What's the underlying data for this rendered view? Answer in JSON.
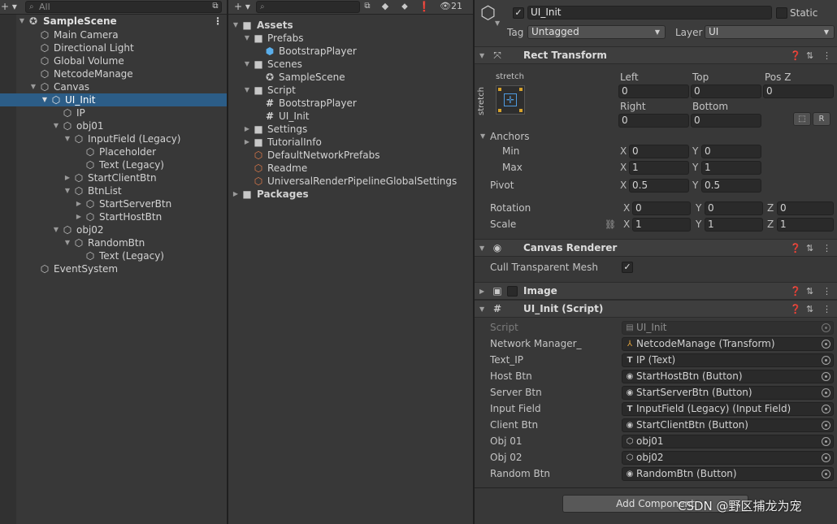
{
  "hierarchy": {
    "add_label": "+ ▾",
    "search_placeholder": "All",
    "scene_name": "SampleScene",
    "items": [
      {
        "label": "Main Camera"
      },
      {
        "label": "Directional Light"
      },
      {
        "label": "Global Volume"
      },
      {
        "label": "NetcodeManage"
      },
      {
        "label": "Canvas"
      },
      {
        "label": "UI_Init"
      },
      {
        "label": "IP"
      },
      {
        "label": "obj01"
      },
      {
        "label": "InputField (Legacy)"
      },
      {
        "label": "Placeholder"
      },
      {
        "label": "Text (Legacy)"
      },
      {
        "label": "StartClientBtn"
      },
      {
        "label": "BtnList"
      },
      {
        "label": "StartServerBtn"
      },
      {
        "label": "StartHostBtn"
      },
      {
        "label": "obj02"
      },
      {
        "label": "RandomBtn"
      },
      {
        "label": "Text (Legacy)"
      },
      {
        "label": "EventSystem"
      }
    ]
  },
  "project": {
    "add_label": "+ ▾",
    "hidden_count": "21",
    "items": [
      {
        "label": "Assets"
      },
      {
        "label": "Prefabs"
      },
      {
        "label": "BootstrapPlayer"
      },
      {
        "label": "Scenes"
      },
      {
        "label": "SampleScene"
      },
      {
        "label": "Script"
      },
      {
        "label": "BootstrapPlayer"
      },
      {
        "label": "UI_Init"
      },
      {
        "label": "Settings"
      },
      {
        "label": "TutorialInfo"
      },
      {
        "label": "DefaultNetworkPrefabs"
      },
      {
        "label": "Readme"
      },
      {
        "label": "UniversalRenderPipelineGlobalSettings"
      },
      {
        "label": "Packages"
      }
    ]
  },
  "inspector": {
    "object_name": "UI_Init",
    "static_label": "Static",
    "tag_label": "Tag",
    "tag_value": "Untagged",
    "layer_label": "Layer",
    "layer_value": "UI",
    "rect": {
      "title": "Rect Transform",
      "preset_top": "stretch",
      "preset_side": "stretch",
      "left_label": "Left",
      "top_label": "Top",
      "posz_label": "Pos Z",
      "right_label": "Right",
      "bottom_label": "Bottom",
      "left": "0",
      "top": "0",
      "posz": "0",
      "right": "0",
      "bottom": "0",
      "r_button": "R",
      "anchors_label": "Anchors",
      "min_label": "Min",
      "max_label": "Max",
      "pivot_label": "Pivot",
      "rotation_label": "Rotation",
      "scale_label": "Scale",
      "x": "X",
      "y": "Y",
      "z": "Z",
      "min_x": "0",
      "min_y": "0",
      "max_x": "1",
      "max_y": "1",
      "pivot_x": "0.5",
      "pivot_y": "0.5",
      "rot_x": "0",
      "rot_y": "0",
      "rot_z": "0",
      "scale_x": "1",
      "scale_y": "1",
      "scale_z": "1"
    },
    "canvas_renderer": {
      "title": "Canvas Renderer",
      "cull_label": "Cull Transparent Mesh"
    },
    "image": {
      "title": "Image"
    },
    "script": {
      "title": "UI_Init (Script)",
      "fields": [
        {
          "label": "Script",
          "value": "UI_Init"
        },
        {
          "label": "Network Manager_",
          "value": "NetcodeManage (Transform)"
        },
        {
          "label": "Text_IP",
          "value": "IP (Text)"
        },
        {
          "label": "Host Btn",
          "value": "StartHostBtn (Button)"
        },
        {
          "label": "Server Btn",
          "value": "StartServerBtn (Button)"
        },
        {
          "label": "Input Field",
          "value": "InputField (Legacy) (Input Field)"
        },
        {
          "label": "Client Btn",
          "value": "StartClientBtn (Button)"
        },
        {
          "label": "Obj 01",
          "value": "obj01"
        },
        {
          "label": "Obj 02",
          "value": "obj02"
        },
        {
          "label": "Random Btn",
          "value": "RandomBtn (Button)"
        }
      ]
    },
    "add_component": "Add Component",
    "watermark": "CSDN @野区捕龙为宠"
  }
}
